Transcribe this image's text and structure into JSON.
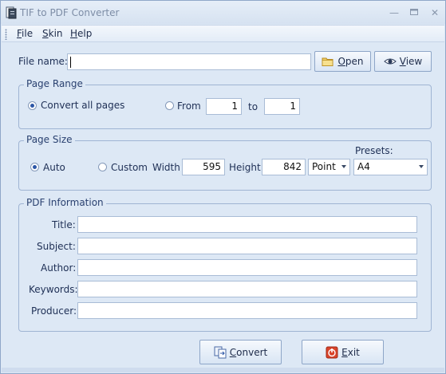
{
  "window": {
    "title": "TIF to PDF Converter",
    "minimize_icon": "minimize-icon",
    "maximize_icon": "maximize-icon",
    "close_icon": "close-icon"
  },
  "menu": {
    "file": {
      "accel": "F",
      "rest": "ile"
    },
    "skin": {
      "accel": "S",
      "rest": "kin"
    },
    "help": {
      "accel": "H",
      "rest": "elp"
    }
  },
  "file": {
    "label": "File name:",
    "value": "",
    "open_button": {
      "accel": "O",
      "rest": "pen",
      "icon": "folder-icon"
    },
    "view_button": {
      "accel": "V",
      "rest": "iew",
      "icon": "eye-icon"
    }
  },
  "page_range": {
    "title": "Page Range",
    "convert_all_label": "Convert all pages",
    "convert_all_checked": true,
    "from_label": "From",
    "from_value": "1",
    "to_label": "to",
    "to_value": "1"
  },
  "page_size": {
    "title": "Page Size",
    "auto_label": "Auto",
    "auto_checked": true,
    "custom_label": "Custom",
    "width_label": "Width",
    "width_value": "595",
    "height_label": "Height",
    "height_value": "842",
    "unit_value": "Point",
    "presets_label": "Presets:",
    "preset_value": "A4"
  },
  "pdf_info": {
    "title": "PDF Information",
    "fields": [
      {
        "label": "Title:",
        "value": ""
      },
      {
        "label": "Subject:",
        "value": ""
      },
      {
        "label": "Author:",
        "value": ""
      },
      {
        "label": "Keywords:",
        "value": ""
      },
      {
        "label": "Producer:",
        "value": ""
      }
    ]
  },
  "actions": {
    "convert": {
      "accel": "C",
      "rest": "onvert",
      "icon": "convert-icon"
    },
    "exit": {
      "accel": "E",
      "rest": "xit",
      "icon": "exit-icon"
    }
  },
  "colors": {
    "accent": "#2c56a6",
    "window_bg": "#dde8f5",
    "border": "#9fb4d3",
    "exit_icon": "#d9442b"
  }
}
